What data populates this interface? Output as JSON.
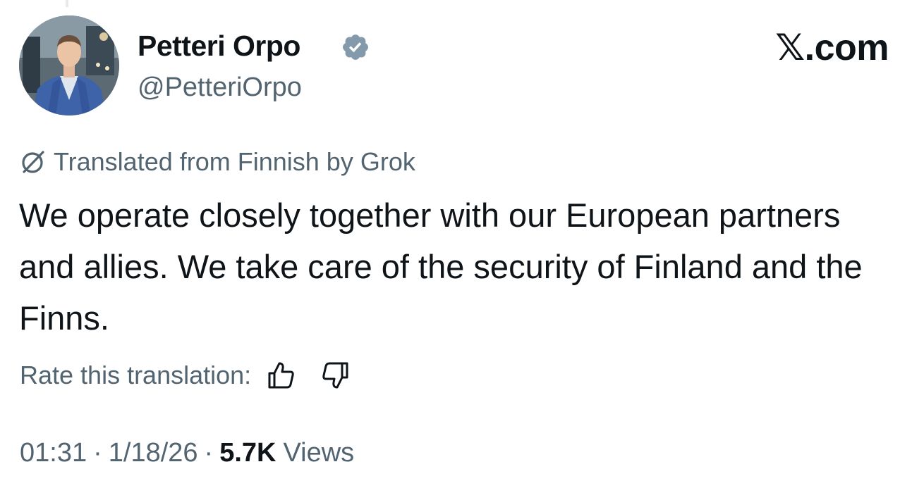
{
  "author": {
    "display_name": "Petteri Orpo",
    "handle": "@PetteriOrpo",
    "verified": true,
    "verified_color": "#829aab"
  },
  "brand": "𝕏.com",
  "translation": {
    "notice": "Translated from Finnish by Grok",
    "icon": "grok-icon",
    "rate_label": "Rate this translation:"
  },
  "tweet": {
    "text": "We operate closely together with our European partners and allies. We take care of the security of Finland and the Finns."
  },
  "meta": {
    "time": "01:31",
    "date": "1/18/26",
    "views_count": "5.7K",
    "views_label": "Views"
  },
  "colors": {
    "text_primary": "#0f1419",
    "text_secondary": "#536471"
  }
}
